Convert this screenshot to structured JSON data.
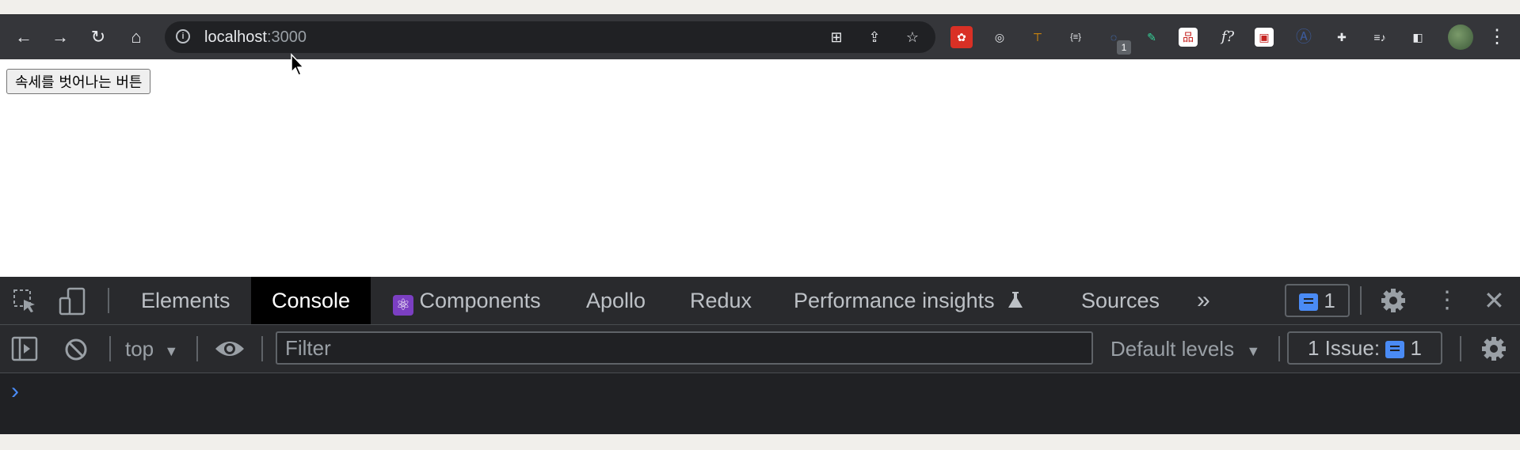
{
  "browser": {
    "url_host": "localhost",
    "url_port": ":3000",
    "nav": {
      "back": "←",
      "forward": "→",
      "reload": "↻",
      "home": "⌂"
    },
    "extension_badge": "1",
    "extensions": [
      {
        "name": "red-extension-icon",
        "glyph": "✿",
        "color": "#d93025"
      },
      {
        "name": "target-extension-icon",
        "glyph": "◎",
        "color": "#35363a"
      },
      {
        "name": "orange-extension-icon",
        "glyph": "⊤",
        "color": "#35363a"
      },
      {
        "name": "json-extension-icon",
        "glyph": "{≡}",
        "color": "#35363a"
      },
      {
        "name": "blue-circle-extension-icon",
        "glyph": "◌",
        "color": "#35363a"
      },
      {
        "name": "highlighter-extension-icon",
        "glyph": "✎",
        "color": "#35363a"
      },
      {
        "name": "sitemap-extension-icon",
        "glyph": "品",
        "color": "#ffffff"
      },
      {
        "name": "function-extension-icon",
        "glyph": "f?",
        "color": "#35363a"
      },
      {
        "name": "white-square-extension-icon",
        "glyph": "▣",
        "color": "#ffffff"
      },
      {
        "name": "a-circle-extension-icon",
        "glyph": "Ⓐ",
        "color": "#35363a"
      },
      {
        "name": "puzzle-extensions-icon",
        "glyph": "✚",
        "color": "#35363a"
      },
      {
        "name": "media-control-icon",
        "glyph": "≡♪",
        "color": "#35363a"
      },
      {
        "name": "side-panel-icon",
        "glyph": "◧",
        "color": "#35363a"
      }
    ]
  },
  "page": {
    "button_label": "속세를 벗어나는 버튼"
  },
  "devtools": {
    "tabs": [
      {
        "label": "Elements",
        "active": false
      },
      {
        "label": "Console",
        "active": true
      },
      {
        "label": "Components",
        "active": false
      },
      {
        "label": "Apollo",
        "active": false
      },
      {
        "label": "Redux",
        "active": false
      },
      {
        "label": "Performance insights",
        "active": false
      },
      {
        "label": "Sources",
        "active": false
      }
    ],
    "more_tabs": "»",
    "issues_count": "1",
    "context": "top",
    "filter_placeholder": "Filter",
    "levels": "Default levels",
    "issue_label": "1 Issue:",
    "issue_count": "1",
    "prompt": "›"
  },
  "colors": {
    "toolbar_bg": "#35363a",
    "devtools_bg": "#202124",
    "accent_blue": "#4a8bf5"
  }
}
